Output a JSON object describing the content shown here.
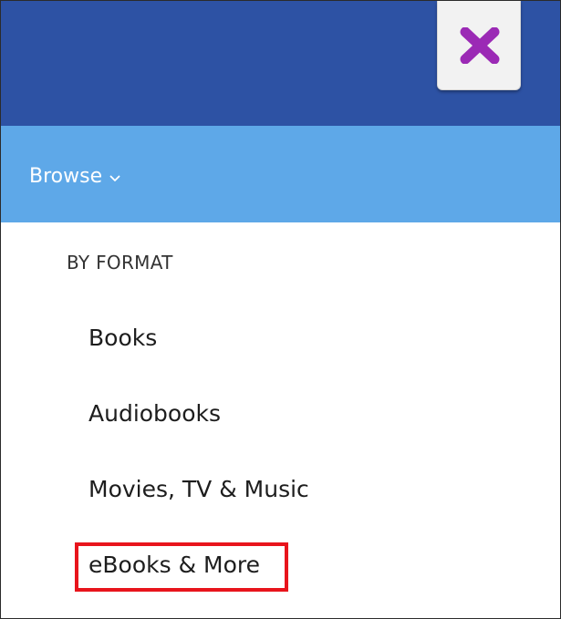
{
  "browse": {
    "label": "Browse",
    "chevron_icon": "chevron-down-icon"
  },
  "close": {
    "icon": "close-x-icon",
    "icon_color": "#9b2ab5"
  },
  "colors": {
    "top_bar": "#2d52a4",
    "browse_bar": "#5ea8e8",
    "highlight": "#e8141c"
  },
  "menu": {
    "heading": "BY FORMAT",
    "items": [
      {
        "label": "Books"
      },
      {
        "label": "Audiobooks"
      },
      {
        "label": "Movies, TV & Music"
      },
      {
        "label": "eBooks & More",
        "highlighted": true
      }
    ]
  }
}
